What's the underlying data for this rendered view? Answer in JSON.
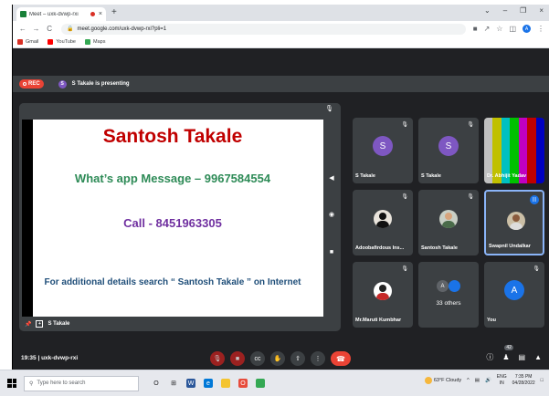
{
  "browser": {
    "tab_title": "Meet – uxk-dvwp-rxi",
    "tab_close": "×",
    "new_tab": "+",
    "window_controls": [
      "⌄",
      "–",
      "❐",
      "×"
    ],
    "url": "meet.google.com/uxk-dvwp-rxi?pli=1",
    "bookmarks": [
      {
        "label": "Gmail",
        "icon": "gmail-icon",
        "color": "#d93025"
      },
      {
        "label": "YouTube",
        "icon": "youtube-icon",
        "color": "#ff0000"
      },
      {
        "label": "Maps",
        "icon": "maps-icon",
        "color": "#34a853"
      }
    ],
    "profile_initial": "A"
  },
  "meet": {
    "rec_label": "REC",
    "presenter_initial": "S",
    "presenting_text": "S Takale is presenting",
    "slide": {
      "title": "Santosh Takale",
      "whatsapp": "What’s app Message – 9967584554",
      "call": "Call - 8451963305",
      "info": "For additional details search “ Santosh Takale ” on Internet"
    },
    "presenter_name": "S Takale",
    "tiles": [
      {
        "name": "S Takale",
        "initial": "S",
        "color": "#7e57c2"
      },
      {
        "name": "S Takale",
        "initial": "S",
        "color": "#7e57c2"
      },
      {
        "name": "Dr. Abhijit Yadav",
        "initial": "",
        "color": ""
      },
      {
        "name": "Adoobafirdous Ins...",
        "initial": "",
        "color": ""
      },
      {
        "name": "Santosh Takale",
        "initial": "",
        "color": ""
      },
      {
        "name": "Swapnil Undalkar",
        "initial": "",
        "color": ""
      },
      {
        "name": "Mr.Maruti Kumbhar",
        "initial": "",
        "color": ""
      },
      {
        "name": "33 others",
        "initial": "A",
        "color": "#1a73e8"
      },
      {
        "name": "You",
        "initial": "A",
        "color": "#1a73e8"
      }
    ],
    "time": "19:35",
    "meeting_code": "uxk-dvwp-rxi",
    "people_count": "42"
  },
  "taskbar": {
    "search_placeholder": "Type here to search",
    "weather": "63°F  Cloudy",
    "lang_top": "ENG",
    "lang_bottom": "IN",
    "time": "7:35 PM",
    "date": "04/28/2022"
  }
}
